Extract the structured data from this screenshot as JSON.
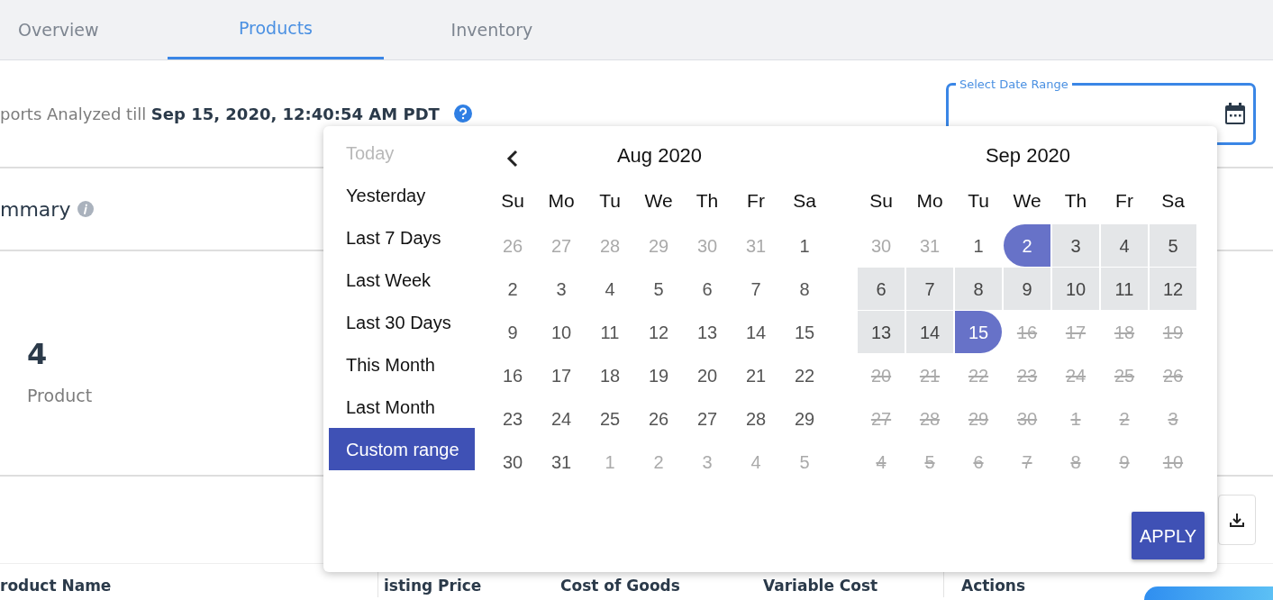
{
  "tabs": [
    {
      "label": "Overview",
      "selected": false
    },
    {
      "label": "Products",
      "selected": true
    },
    {
      "label": "Inventory",
      "selected": false
    }
  ],
  "report": {
    "text": "ports Analyzed till **Sep 15, 2020, 12:40:54 AM PDT**"
  },
  "date_field": {
    "label": "Select Date Range"
  },
  "summary": {
    "title": "mmary"
  },
  "stat": {
    "value": "4",
    "label": "Product"
  },
  "table": {
    "columns": [
      "roduct Name",
      "isting Price",
      "Cost of Goods",
      "Variable Cost",
      "Actions"
    ]
  },
  "date_picker": {
    "ranges": [
      {
        "label": "Today",
        "selected": false,
        "disabled": true
      },
      {
        "label": "Yesterday",
        "selected": false,
        "disabled": false
      },
      {
        "label": "Last 7 Days",
        "selected": false,
        "disabled": false
      },
      {
        "label": "Last Week",
        "selected": false,
        "disabled": false
      },
      {
        "label": "Last 30 Days",
        "selected": false,
        "disabled": false
      },
      {
        "label": "This Month",
        "selected": false,
        "disabled": false
      },
      {
        "label": "Last Month",
        "selected": false,
        "disabled": false
      },
      {
        "label": "Custom range",
        "selected": true,
        "disabled": false
      }
    ],
    "calendars": [
      {
        "title": "Aug 2020",
        "prev_arrow": true,
        "weekdays": [
          "Su",
          "Mo",
          "Tu",
          "We",
          "Th",
          "Fr",
          "Sa"
        ],
        "weeks": [
          [
            {
              "day": "26",
              "outside": true
            },
            {
              "day": "27",
              "outside": true
            },
            {
              "day": "28",
              "outside": true
            },
            {
              "day": "29",
              "outside": true
            },
            {
              "day": "30",
              "outside": true
            },
            {
              "day": "31",
              "outside": true
            },
            {
              "day": "1"
            }
          ],
          [
            {
              "day": "2"
            },
            {
              "day": "3"
            },
            {
              "day": "4"
            },
            {
              "day": "5"
            },
            {
              "day": "6"
            },
            {
              "day": "7"
            },
            {
              "day": "8"
            }
          ],
          [
            {
              "day": "9"
            },
            {
              "day": "10"
            },
            {
              "day": "11"
            },
            {
              "day": "12"
            },
            {
              "day": "13"
            },
            {
              "day": "14"
            },
            {
              "day": "15"
            }
          ],
          [
            {
              "day": "16"
            },
            {
              "day": "17"
            },
            {
              "day": "18"
            },
            {
              "day": "19"
            },
            {
              "day": "20"
            },
            {
              "day": "21"
            },
            {
              "day": "22"
            }
          ],
          [
            {
              "day": "23"
            },
            {
              "day": "24"
            },
            {
              "day": "25"
            },
            {
              "day": "26"
            },
            {
              "day": "27"
            },
            {
              "day": "28"
            },
            {
              "day": "29"
            }
          ],
          [
            {
              "day": "30"
            },
            {
              "day": "31"
            },
            {
              "day": "1",
              "outside": true
            },
            {
              "day": "2",
              "outside": true
            },
            {
              "day": "3",
              "outside": true
            },
            {
              "day": "4",
              "outside": true
            },
            {
              "day": "5",
              "outside": true
            }
          ]
        ]
      },
      {
        "title": "Sep 2020",
        "weekdays": [
          "Su",
          "Mo",
          "Tu",
          "We",
          "Th",
          "Fr",
          "Sa"
        ],
        "weeks": [
          [
            {
              "day": "30",
              "outside": true
            },
            {
              "day": "31",
              "outside": true
            },
            {
              "day": "1"
            },
            {
              "day": "2",
              "selected": true,
              "in_range": true
            },
            {
              "day": "3",
              "in_range": true
            },
            {
              "day": "4",
              "in_range": true
            },
            {
              "day": "5",
              "in_range": true
            }
          ],
          [
            {
              "day": "6",
              "in_range": true
            },
            {
              "day": "7",
              "in_range": true
            },
            {
              "day": "8",
              "in_range": true
            },
            {
              "day": "9",
              "in_range": true
            },
            {
              "day": "10",
              "in_range": true
            },
            {
              "day": "11",
              "in_range": true
            },
            {
              "day": "12",
              "in_range": true
            }
          ],
          [
            {
              "day": "13",
              "in_range": true
            },
            {
              "day": "14",
              "in_range": true
            },
            {
              "day": "15",
              "selected": true,
              "in_range": true
            },
            {
              "day": "16",
              "disabled": true
            },
            {
              "day": "17",
              "disabled": true
            },
            {
              "day": "18",
              "disabled": true
            },
            {
              "day": "19",
              "disabled": true
            }
          ],
          [
            {
              "day": "20",
              "disabled": true
            },
            {
              "day": "21",
              "disabled": true
            },
            {
              "day": "22",
              "disabled": true
            },
            {
              "day": "23",
              "disabled": true
            },
            {
              "day": "24",
              "disabled": true
            },
            {
              "day": "25",
              "disabled": true
            },
            {
              "day": "26",
              "disabled": true
            }
          ],
          [
            {
              "day": "27",
              "disabled": true
            },
            {
              "day": "28",
              "disabled": true
            },
            {
              "day": "29",
              "disabled": true
            },
            {
              "day": "30",
              "disabled": true
            },
            {
              "day": "1",
              "disabled": true
            },
            {
              "day": "2",
              "disabled": true
            },
            {
              "day": "3",
              "disabled": true
            }
          ],
          [
            {
              "day": "4",
              "disabled": true
            },
            {
              "day": "5",
              "disabled": true
            },
            {
              "day": "6",
              "disabled": true
            },
            {
              "day": "7",
              "disabled": true
            },
            {
              "day": "8",
              "disabled": true
            },
            {
              "day": "9",
              "disabled": true
            },
            {
              "day": "10",
              "disabled": true
            }
          ]
        ]
      }
    ],
    "apply_label": "APPLY"
  }
}
